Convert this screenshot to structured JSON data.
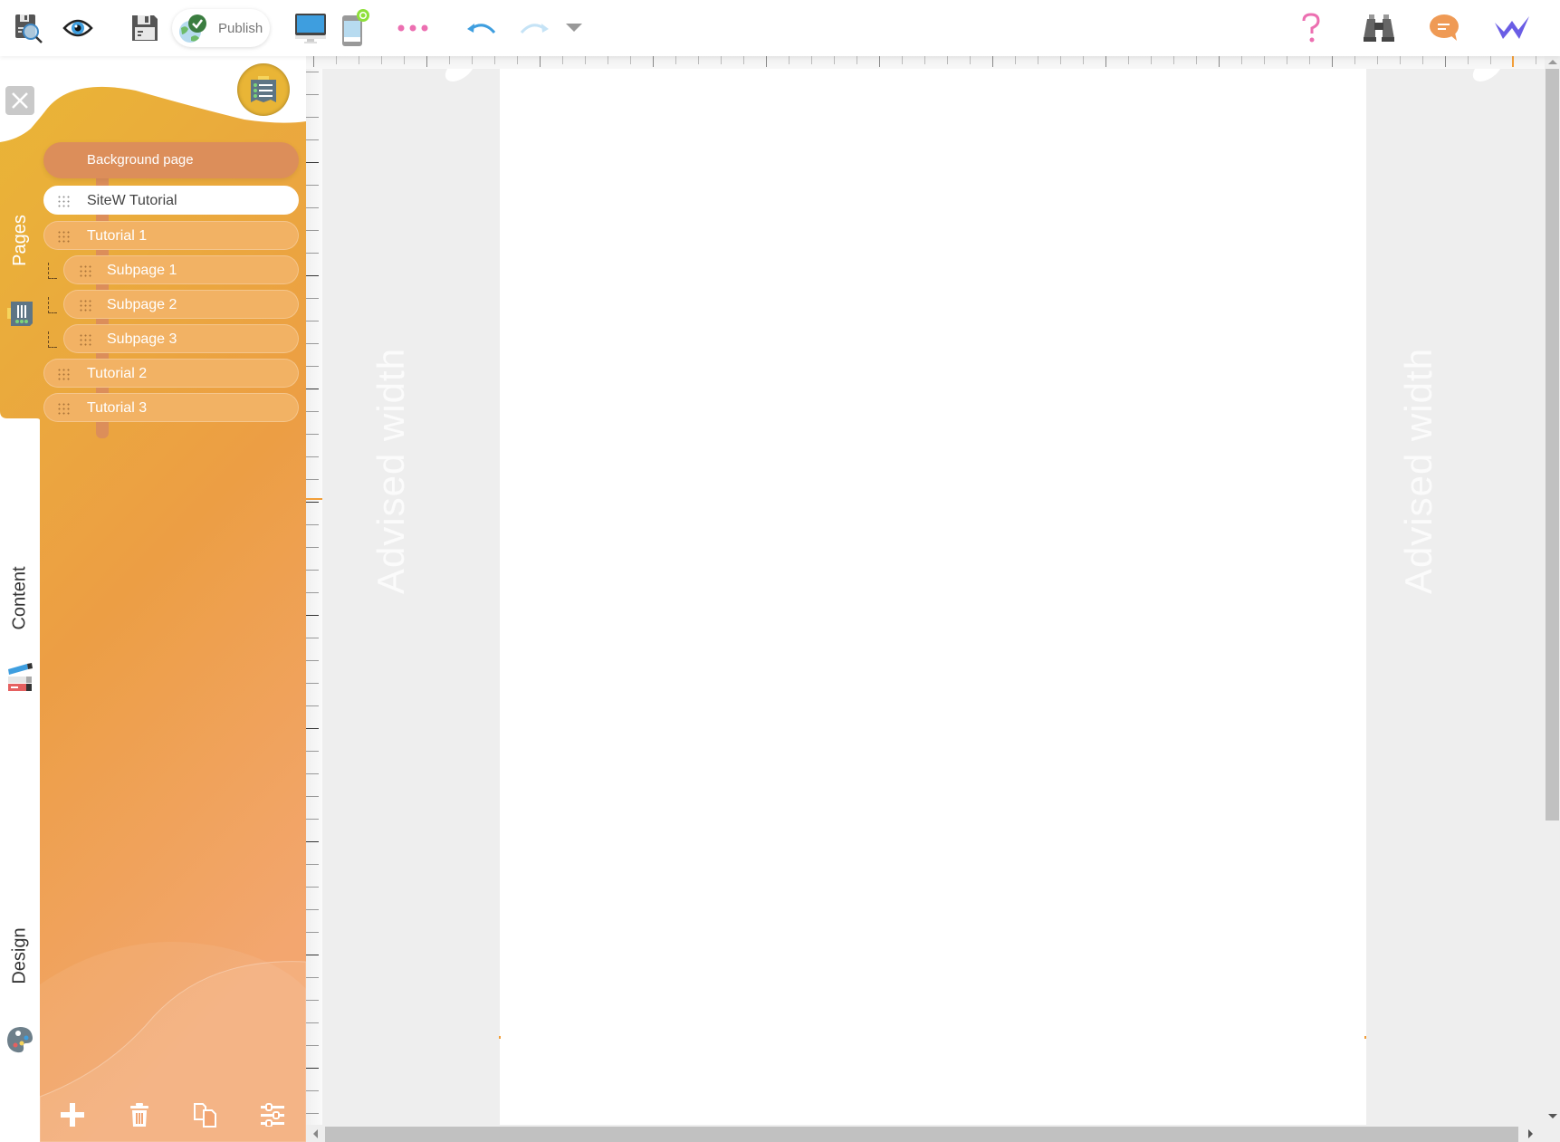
{
  "toolbar": {
    "left_icons": [
      "save-preview-icon",
      "eye-icon",
      "save-icon"
    ],
    "publish_label": "Publish",
    "device_icons": [
      "desktop-icon",
      "mobile-icon"
    ],
    "more_icon": "more-dots-icon",
    "undo_icon": "undo-icon",
    "redo_icon": "redo-icon",
    "history_dropdown_icon": "caret-down-icon",
    "right_icons": [
      "help-icon",
      "binoculars-icon",
      "chat-icon",
      "sitew-logo-icon"
    ],
    "colors": {
      "help": "#ec6fb1",
      "chat": "#ef9a55",
      "logo": "#6a5de5",
      "undo": "#3e9edf",
      "redo": "#c5e3f6",
      "more": "#ec6fb1",
      "publish_check": "#3b7d40"
    }
  },
  "tabs": [
    {
      "label": "Pages",
      "icon": "pages-icon",
      "active": true
    },
    {
      "label": "Content",
      "icon": "content-icon",
      "active": false
    },
    {
      "label": "Design",
      "icon": "palette-icon",
      "active": false
    }
  ],
  "sidebar": {
    "close_icon": "close-icon",
    "header_icon": "page-list-icon",
    "background_page_label": "Background page",
    "pages": [
      {
        "title": "SiteW Tutorial",
        "level": 0,
        "active": true
      },
      {
        "title": "Tutorial 1",
        "level": 0,
        "active": false
      },
      {
        "title": "Subpage 1",
        "level": 1,
        "active": false
      },
      {
        "title": "Subpage 2",
        "level": 1,
        "active": false
      },
      {
        "title": "Subpage 3",
        "level": 1,
        "active": false
      },
      {
        "title": "Tutorial 2",
        "level": 0,
        "active": false
      },
      {
        "title": "Tutorial 3",
        "level": 0,
        "active": false
      }
    ],
    "bottom_tools": [
      {
        "name": "add-page",
        "icon": "plus-icon"
      },
      {
        "name": "delete-page",
        "icon": "trash-icon"
      },
      {
        "name": "duplicate-page",
        "icon": "copy-icon"
      },
      {
        "name": "page-settings",
        "icon": "sliders-icon"
      }
    ],
    "colors": {
      "top": "#e9b536",
      "bottom": "#f2a572",
      "row": "#f2b264",
      "connector": "#dc8e5a"
    }
  },
  "canvas": {
    "advised_width_label_left": "Advised width",
    "advised_width_label_right": "Advised width",
    "margin_color": "#eeeeee",
    "guide_color": "#f29e38"
  }
}
